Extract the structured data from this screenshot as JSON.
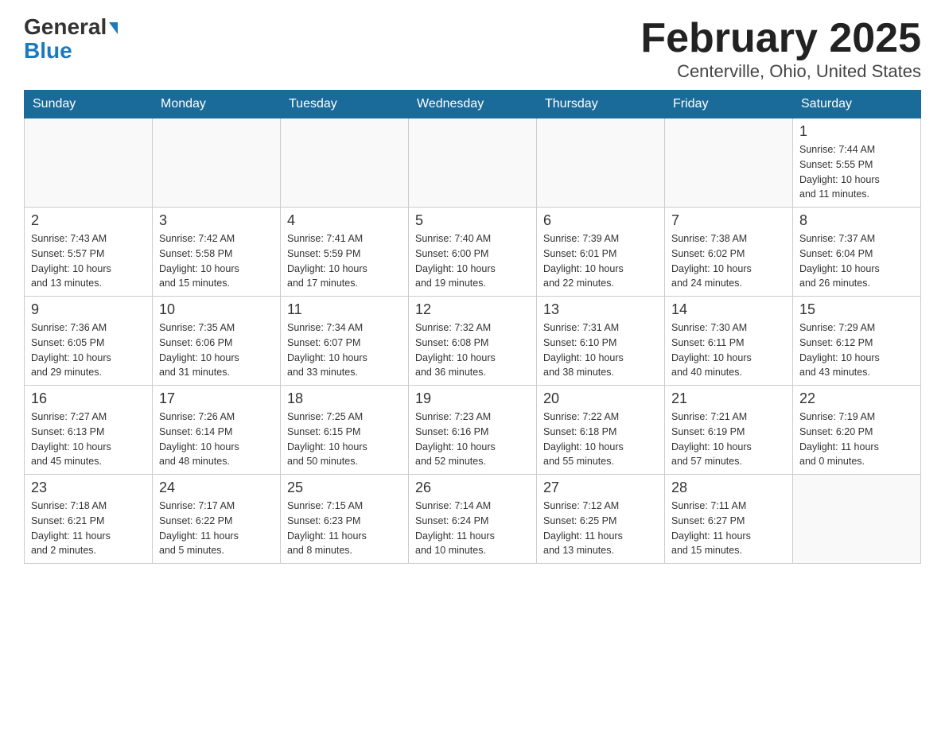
{
  "header": {
    "logo_main": "General",
    "logo_sub": "Blue",
    "title": "February 2025",
    "subtitle": "Centerville, Ohio, United States"
  },
  "days_of_week": [
    "Sunday",
    "Monday",
    "Tuesday",
    "Wednesday",
    "Thursday",
    "Friday",
    "Saturday"
  ],
  "weeks": [
    [
      {
        "day": "",
        "info": ""
      },
      {
        "day": "",
        "info": ""
      },
      {
        "day": "",
        "info": ""
      },
      {
        "day": "",
        "info": ""
      },
      {
        "day": "",
        "info": ""
      },
      {
        "day": "",
        "info": ""
      },
      {
        "day": "1",
        "info": "Sunrise: 7:44 AM\nSunset: 5:55 PM\nDaylight: 10 hours\nand 11 minutes."
      }
    ],
    [
      {
        "day": "2",
        "info": "Sunrise: 7:43 AM\nSunset: 5:57 PM\nDaylight: 10 hours\nand 13 minutes."
      },
      {
        "day": "3",
        "info": "Sunrise: 7:42 AM\nSunset: 5:58 PM\nDaylight: 10 hours\nand 15 minutes."
      },
      {
        "day": "4",
        "info": "Sunrise: 7:41 AM\nSunset: 5:59 PM\nDaylight: 10 hours\nand 17 minutes."
      },
      {
        "day": "5",
        "info": "Sunrise: 7:40 AM\nSunset: 6:00 PM\nDaylight: 10 hours\nand 19 minutes."
      },
      {
        "day": "6",
        "info": "Sunrise: 7:39 AM\nSunset: 6:01 PM\nDaylight: 10 hours\nand 22 minutes."
      },
      {
        "day": "7",
        "info": "Sunrise: 7:38 AM\nSunset: 6:02 PM\nDaylight: 10 hours\nand 24 minutes."
      },
      {
        "day": "8",
        "info": "Sunrise: 7:37 AM\nSunset: 6:04 PM\nDaylight: 10 hours\nand 26 minutes."
      }
    ],
    [
      {
        "day": "9",
        "info": "Sunrise: 7:36 AM\nSunset: 6:05 PM\nDaylight: 10 hours\nand 29 minutes."
      },
      {
        "day": "10",
        "info": "Sunrise: 7:35 AM\nSunset: 6:06 PM\nDaylight: 10 hours\nand 31 minutes."
      },
      {
        "day": "11",
        "info": "Sunrise: 7:34 AM\nSunset: 6:07 PM\nDaylight: 10 hours\nand 33 minutes."
      },
      {
        "day": "12",
        "info": "Sunrise: 7:32 AM\nSunset: 6:08 PM\nDaylight: 10 hours\nand 36 minutes."
      },
      {
        "day": "13",
        "info": "Sunrise: 7:31 AM\nSunset: 6:10 PM\nDaylight: 10 hours\nand 38 minutes."
      },
      {
        "day": "14",
        "info": "Sunrise: 7:30 AM\nSunset: 6:11 PM\nDaylight: 10 hours\nand 40 minutes."
      },
      {
        "day": "15",
        "info": "Sunrise: 7:29 AM\nSunset: 6:12 PM\nDaylight: 10 hours\nand 43 minutes."
      }
    ],
    [
      {
        "day": "16",
        "info": "Sunrise: 7:27 AM\nSunset: 6:13 PM\nDaylight: 10 hours\nand 45 minutes."
      },
      {
        "day": "17",
        "info": "Sunrise: 7:26 AM\nSunset: 6:14 PM\nDaylight: 10 hours\nand 48 minutes."
      },
      {
        "day": "18",
        "info": "Sunrise: 7:25 AM\nSunset: 6:15 PM\nDaylight: 10 hours\nand 50 minutes."
      },
      {
        "day": "19",
        "info": "Sunrise: 7:23 AM\nSunset: 6:16 PM\nDaylight: 10 hours\nand 52 minutes."
      },
      {
        "day": "20",
        "info": "Sunrise: 7:22 AM\nSunset: 6:18 PM\nDaylight: 10 hours\nand 55 minutes."
      },
      {
        "day": "21",
        "info": "Sunrise: 7:21 AM\nSunset: 6:19 PM\nDaylight: 10 hours\nand 57 minutes."
      },
      {
        "day": "22",
        "info": "Sunrise: 7:19 AM\nSunset: 6:20 PM\nDaylight: 11 hours\nand 0 minutes."
      }
    ],
    [
      {
        "day": "23",
        "info": "Sunrise: 7:18 AM\nSunset: 6:21 PM\nDaylight: 11 hours\nand 2 minutes."
      },
      {
        "day": "24",
        "info": "Sunrise: 7:17 AM\nSunset: 6:22 PM\nDaylight: 11 hours\nand 5 minutes."
      },
      {
        "day": "25",
        "info": "Sunrise: 7:15 AM\nSunset: 6:23 PM\nDaylight: 11 hours\nand 8 minutes."
      },
      {
        "day": "26",
        "info": "Sunrise: 7:14 AM\nSunset: 6:24 PM\nDaylight: 11 hours\nand 10 minutes."
      },
      {
        "day": "27",
        "info": "Sunrise: 7:12 AM\nSunset: 6:25 PM\nDaylight: 11 hours\nand 13 minutes."
      },
      {
        "day": "28",
        "info": "Sunrise: 7:11 AM\nSunset: 6:27 PM\nDaylight: 11 hours\nand 15 minutes."
      },
      {
        "day": "",
        "info": ""
      }
    ]
  ]
}
